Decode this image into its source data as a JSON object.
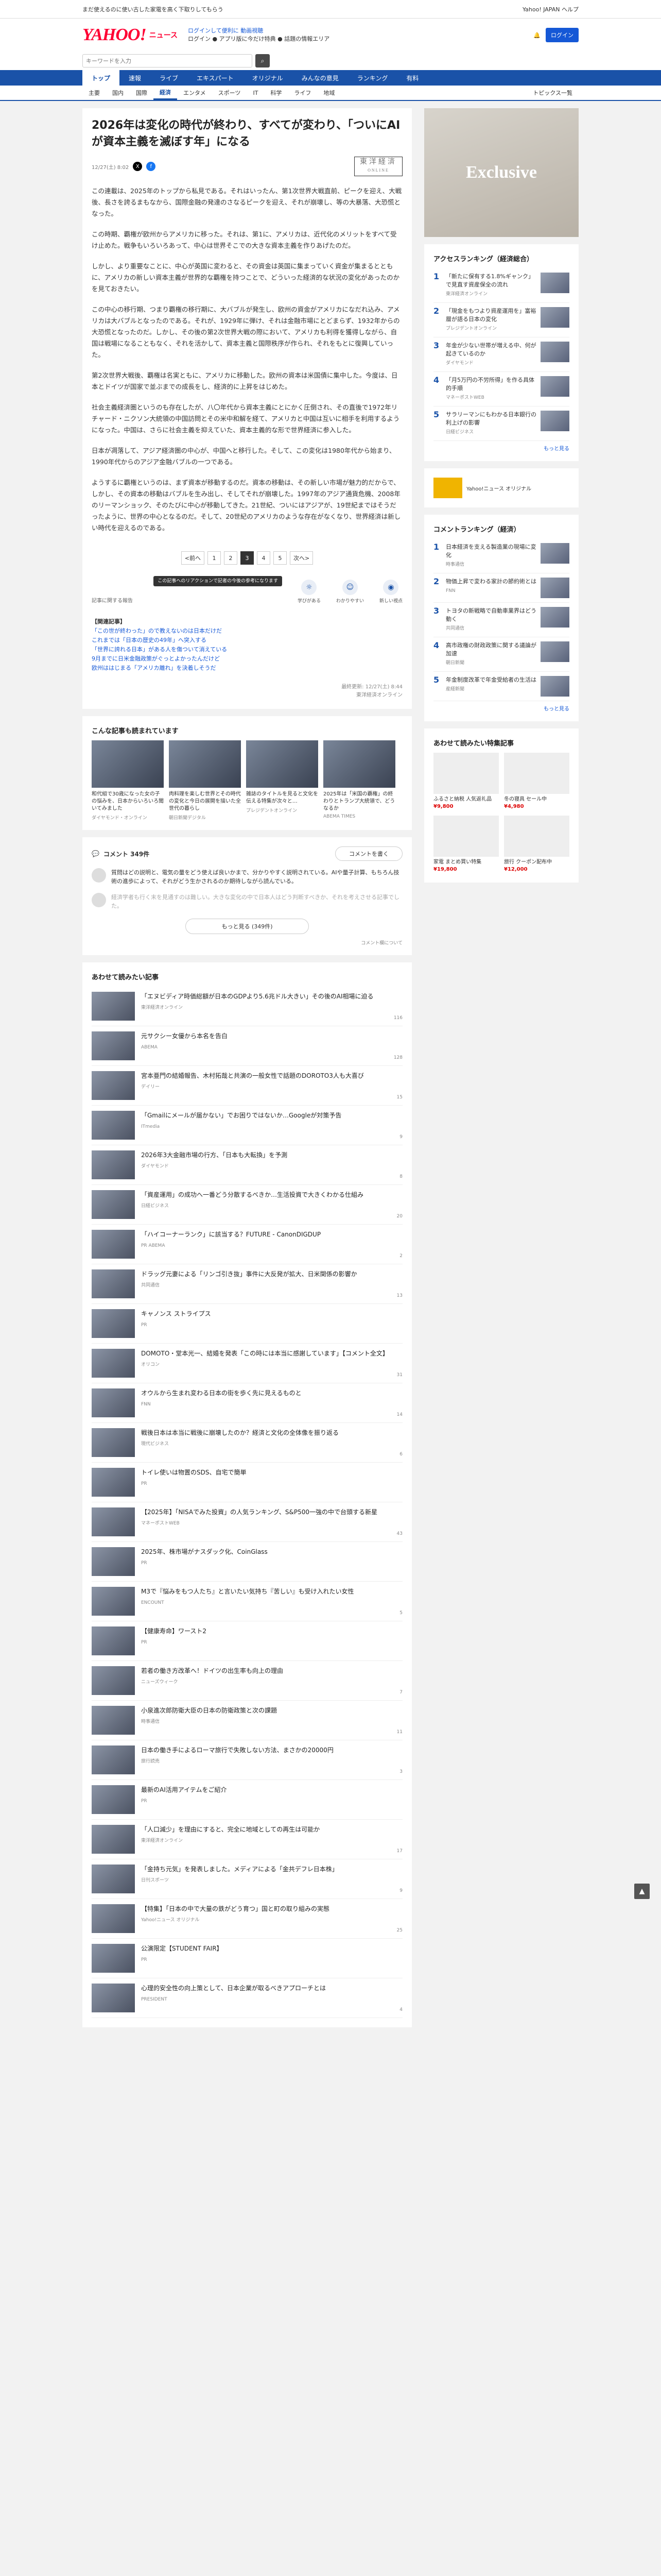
{
  "topbar": {
    "promo": "まだ使えるのに使い古した家電を高く下取りしてもらう",
    "right": "Yahoo! JAPAN ヘルプ"
  },
  "header": {
    "logo": "YAHOO!",
    "section": "ニュース",
    "line1": "ログインして便利に 動画視聴",
    "line2": "ログイン ● アプリ版に今だけ特典 ● 話題の情報エリア",
    "login_label": "ログイン"
  },
  "search": {
    "placeholder": "キーワードを入力",
    "button": "検索"
  },
  "nav1": [
    "トップ",
    "速報",
    "ライブ",
    "エキスパート",
    "オリジナル",
    "みんなの意見",
    "ランキング",
    "有料"
  ],
  "nav2": [
    "主要",
    "国内",
    "国際",
    "経済",
    "エンタメ",
    "スポーツ",
    "IT",
    "科学",
    "ライフ",
    "地域"
  ],
  "nav2_right": "トピックス一覧",
  "article": {
    "title": "2026年は変化の時代が終わり、すべてが変わり、「ついにAIが資本主義を滅ぼす年」になる",
    "date": "12/27(土) 8:02",
    "publisher": "東洋経済",
    "publisher_sub": "ONLINE",
    "paragraphs": [
      "この連載は、2025年のトップから私見である。それはいったん、第1次世界大戦直前、ピークを迎え、大戦後、長さを誇るまもなから、国際金融の発達のさなるピークを迎え、それが崩壊し、等の大暴落、大恐慌となった。",
      "この時期、覇権が欧州からアメリカに移った。それは、第1に、アメリカは、近代化のメリットをすべて受け止めた。戦争もいろいろあって、中心は世界そこでの大きな資本主義を作りあげたのだ。",
      "しかし、より重要なことに、中心が英国に変わると、その資金は英国に集まっていく資金が集まるとともに、アメリカの新しい資本主義が世界的な覇権を持つことで、どういった経済的な状況の変化があったのかを見ておきたい。",
      "この中心の移行期、つまり覇権の移行期に、大バブルが発生し、欧州の資金がアメリカになだれ込み、アメリカは大バブルとなったのである。それが、1929年に弾け、それは金融市場にとどまらず、1932年からの大恐慌となったのだ。しかし、その後の第2次世界大戦の際において、アメリカも利得を獲得しながら、自国は戦場になることもなく、それを活かして、資本主義と国際秩序が作られ、それをもとに復興していった。",
      "第2次世界大戦後、覇権は名実ともに、アメリカに移動した。欧州の資本は米国債に集中した。今度は、日本とドイツが国家で並ぶまでの成長をし、経済的に上昇をはじめた。",
      "社会主義経済圏というのも存在したが、八〇年代から資本主義にとにかく圧倒され、その直後で1972年リチャード・ニクソン大統領の中国訪問とその米中和解を経て、アメリカと中国は互いに相手を利用するようになった。中国は、さらに社会主義を抑えていた、資本主義的な形で世界経済に参入した。",
      "日本が凋落して、アジア経済圏の中心が、中国へと移行した。そして、この変化は1980年代から始まり、1990年代からのアジア金融バブルの一つである。",
      "ようするに覇権というのは、まず資本が移動するのだ。資本の移動は、その新しい市場が魅力的だからで、しかし、その資本の移動はバブルを生み出し、そしてそれが崩壊した。1997年のアジア通貨危機、2008年のリーマンショック、そのたびに中心が移動してきた。21世紀、ついにはアジアが、19世紀まではそうだったように、世界の中心となるのだ。そして、20世紀のアメリカのような存在がなくなり、世界経済は新しい時代を迎えるのである。"
    ],
    "pages": [
      "<前へ",
      "1",
      "2",
      "3",
      "4",
      "5",
      "次へ>"
    ],
    "active_page": "3",
    "reaction_note": "記事に関する報告",
    "tooltip": "この記事へのリアクションで記者の今後の参考になります",
    "reactions": [
      "学びがある",
      "わかりやすい",
      "新しい視点"
    ],
    "related_head": "【関連記事】",
    "related": [
      "「この世が終わった」ので教えないのは日本だけだ",
      "これまでは「日本の歴史の49年」へ突入する",
      "「世界に誇れる日本」がある人を傷ついて消えている",
      "9月までに日米金融政策がぐっとよかったんだけど",
      "欧州ははじまる「アメリカ離れ」を決着しそうだ"
    ],
    "source_line": "最終更新: 12/27(土) 8:44",
    "source_name": "東洋経済オンライン"
  },
  "recommended": {
    "title": "こんな記事も読まれています",
    "items": [
      {
        "cap": "和代組で30歳になった女の子の悩みを、日本からいろいろ聞いてみました",
        "src": "ダイヤモンド・オンライン"
      },
      {
        "cap": "肉料理を楽しむ世界とその時代の変化と今日の展開を描いた全世代の暮らし",
        "src": "朝日新聞デジタル"
      },
      {
        "cap": "雑誌のタイトルを見ると文化を伝える特集が次々と…",
        "src": "プレジデントオンライン"
      },
      {
        "cap": "2025年は「米国の覇権」の終わりとトランプ大統領で、どうなるか",
        "src": "ABEMA TIMES"
      }
    ]
  },
  "comments": {
    "label": "コメント 349件",
    "button": "コメントを書く",
    "c1": "質問はどの説明と、電気の量をどう使えば良いかまで、分かりやすく説明されている。AIや量子計算、もちろん技術の進歩によって、それがどう生かされるのか期待しながら読んでいる。",
    "c2": "経済学者も行く末を見通すのは難しい。大きな変化の中で日本人はどう判断すべきか、それを考えさせる記事でした。",
    "more": "もっと見る (349件)",
    "note": "コメント欄について"
  },
  "feed": {
    "title": "あわせて読みたい記事",
    "items": [
      {
        "t": "「エヌビディア時価総額が日本のGDPより5.6兆ドル大きい」その後のAI相場に迫る",
        "s": "東洋経済オンライン",
        "n": "116"
      },
      {
        "t": "元サクシー女優から本名を告白",
        "s": "ABEMA",
        "n": "128"
      },
      {
        "t": "宮本亜門の結婚報告、木村拓哉と共演の一般女性で話題のDOROTO3人も大喜び",
        "s": "デイリー",
        "n": "15"
      },
      {
        "t": "「Gmailにメールが届かない」でお困りではないか…Googleが対策予告",
        "s": "ITmedia",
        "n": "9"
      },
      {
        "t": "2026年3大金融市場の行方、「日本も大転換」を予測",
        "s": "ダイヤモンド",
        "n": "8"
      },
      {
        "t": "「資産運用」の成功へ一番どう分散するべきか…生活投資で大きくわかる仕組み",
        "s": "日経ビジネス",
        "n": "20"
      },
      {
        "t": "「ハイコーナーランク」に該当する？FUTURE - CanonDIGDUP",
        "s": "PR ABEMA",
        "n": "2"
      },
      {
        "t": "ドラッグ元妻による「リンゴ引き抜」事件に大反発が拡大、日米関係の影響か",
        "s": "共同通信",
        "n": "13"
      },
      {
        "t": "キャノンス ストライプス",
        "s": "PR",
        "n": ""
      },
      {
        "t": "DOMOTO・堂本光一、結婚を発表「この時には本当に感謝しています」【コメント全文】",
        "s": "オリコン",
        "n": "31"
      },
      {
        "t": "オウルから生まれ変わる日本の街を歩く先に見えるものと",
        "s": "FNN",
        "n": "14"
      },
      {
        "t": "戦後日本は本当に戦後に崩壊したのか？経済と文化の全体像を振り返る",
        "s": "現代ビジネス",
        "n": "6"
      },
      {
        "t": "トイレ使いは物置のSDS、自宅で簡単",
        "s": "PR",
        "n": ""
      },
      {
        "t": "【2025年】「NISAでみた投資」の人気ランキング、S&P500一強の中で台頭する新星",
        "s": "マネーポストWEB",
        "n": "43"
      },
      {
        "t": "2025年、株市場がナスダック化、CoinGlass",
        "s": "PR",
        "n": ""
      },
      {
        "t": "M3で『悩みをもつ人たち』と言いたい気持ち『苦しい』も受け入れたい女性",
        "s": "ENCOUNT",
        "n": "5"
      },
      {
        "t": "【健康寿命】ワースト2",
        "s": "PR",
        "n": ""
      },
      {
        "t": "若者の働き方改革へ！ドイツの出生率も向上の理由",
        "s": "ニューズウィーク",
        "n": "7"
      },
      {
        "t": "小泉進次郎防衛大臣の日本の防衛政策と次の課題",
        "s": "時事通信",
        "n": "11"
      },
      {
        "t": "日本の働き手によるローマ旅行で失敗しない方法、まさかの20000円",
        "s": "旅行読売",
        "n": "3"
      },
      {
        "t": "最新のAI活用アイテムをご紹介",
        "s": "PR",
        "n": ""
      },
      {
        "t": "「人口減少」を理由にすると、完全に地域としての再生は可能か",
        "s": "東洋経済オンライン",
        "n": "17"
      },
      {
        "t": "「金持ち元気」を発表しました。メディアによる「金共デフレ日本株」",
        "s": "日刊スポーツ",
        "n": "9"
      },
      {
        "t": "【特集】「日本の中で大量の鉄がどう育つ」国と町の取り組みの実態",
        "s": "Yahoo!ニュース オリジナル",
        "n": "25"
      },
      {
        "t": "公演限定【STUDENT FAIR】",
        "s": "PR",
        "n": ""
      },
      {
        "t": "心理的安全性の向上策として、日本企業が取るべきアプローチとは",
        "s": "PRESIDENT",
        "n": "4"
      }
    ]
  },
  "side": {
    "ad_text": "Exclusive",
    "access_title": "アクセスランキング（経済総合）",
    "access": [
      {
        "t": "「新たに保有する1.8%ギャンク」で見直す資産保全の流れ",
        "s": "東洋経済オンライン"
      },
      {
        "t": "「現金をもつより資産運用を」富裕層が語る日本の変化",
        "s": "プレジデントオンライン"
      },
      {
        "t": "年金が少ない世帯が増える中、何が起きているのか",
        "s": "ダイヤモンド"
      },
      {
        "t": "「月5万円の不労所得」を作る具体的手順",
        "s": "マネーポストWEB"
      },
      {
        "t": "サラリーマンにもわかる日本銀行の利上げの影響",
        "s": "日経ビジネス"
      }
    ],
    "promo1": "Yahoo!ニュース オリジナル",
    "comment_title": "コメントランキング（経済）",
    "comment_rank": [
      {
        "t": "日本経済を支える製造業の現場に変化",
        "s": "時事通信"
      },
      {
        "t": "物価上昇で変わる家計の節約術とは",
        "s": "FNN"
      },
      {
        "t": "トヨタの新戦略で自動車業界はどう動く",
        "s": "共同通信"
      },
      {
        "t": "高市政権の財政政策に関する議論が加速",
        "s": "朝日新聞"
      },
      {
        "t": "年金制度改革で年金受給者の生活は",
        "s": "産経新聞"
      }
    ],
    "shop_title": "あわせて読みたい特集記事",
    "shop": [
      {
        "name": "ふるさと納税 人気返礼品",
        "price": "¥9,800"
      },
      {
        "name": "冬の寝具 セール中",
        "price": "¥4,980"
      },
      {
        "name": "家電 まとめ買い特集",
        "price": "¥19,800"
      },
      {
        "name": "旅行 クーポン配布中",
        "price": "¥12,000"
      }
    ],
    "more": "もっと見る"
  },
  "colors": {
    "brand": "#ff0033",
    "nav": "#1a52a8",
    "link": "#1558d6"
  }
}
